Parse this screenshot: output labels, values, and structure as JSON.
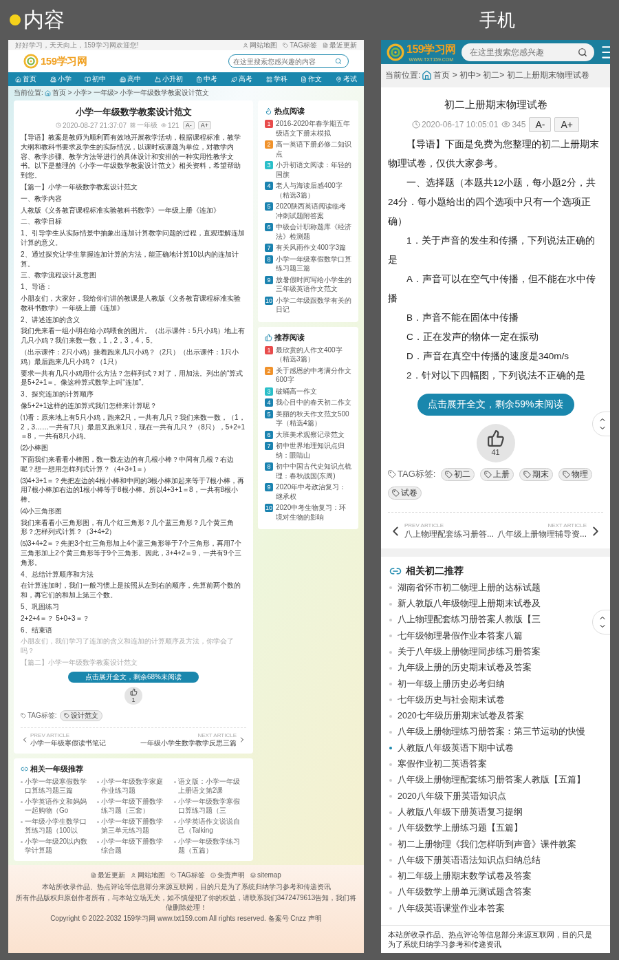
{
  "showcase_labels": {
    "desktop": "内容",
    "mobile": "手机"
  },
  "desktop": {
    "top_bar": {
      "greeting": "好好学习，天天向上，159学习网欢迎您!",
      "links": [
        "网站地图",
        "TAG标签",
        "最近更新"
      ]
    },
    "logo": {
      "name": "159学习网"
    },
    "search": {
      "placeholder": "在这里搜索您感兴趣的内容"
    },
    "nav": [
      "首页",
      "小学",
      "初中",
      "高中",
      "小升初",
      "中考",
      "高考",
      "学科",
      "作文",
      "考试"
    ],
    "breadcrumb": {
      "label": "当前位置:",
      "path": "首页 > 小学> 一年级> 小学一年级数学教案设计范文"
    },
    "article": {
      "title": "小学一年级数学教案设计范文",
      "date": "2020-08-27 21:37:07",
      "category": "一年级",
      "views": "121",
      "font_buttons": [
        "A-",
        "A+"
      ],
      "paragraphs": [
        {
          "kind": "text",
          "text": "【导语】教案是教师为顺利而有效地开展教学活动，根据课程标准，教学大纲和教科书要求及学生的实际情况，以课时或课题为单位，对教学内容、教学步骤、教学方法等进行的具体设计和安排的一种实用性教学文书。以下是整理的《小学一年级数学教案设计范文》相关资料，希望帮助到您。"
        },
        {
          "kind": "text",
          "text": "【篇一】小学一年级数学教案设计范文"
        },
        {
          "kind": "text",
          "text": "一、教学内容"
        },
        {
          "kind": "text",
          "text": "人教版《义务教育课程标准实验教科书数学》一年级上册《连加》"
        },
        {
          "kind": "text",
          "text": "二、教学目标"
        },
        {
          "kind": "text",
          "text": "1、引导学生从实际情景中抽象出连加计算教学问题的过程，直观理解连加计算的意义。"
        },
        {
          "kind": "text",
          "text": "2、通过探究让学生掌握连加计算的方法，能正确地计算10以内的连加计算。"
        },
        {
          "kind": "text",
          "text": "三、教学流程设计及意图"
        },
        {
          "kind": "text",
          "text": "1、导语："
        },
        {
          "kind": "text",
          "text": "小朋友们，大家好，我给你们讲的教课是人教版《义务教育课程标准实验教科书数学》一年级上册《连加》"
        },
        {
          "kind": "text",
          "text": "2、讲述连加的含义"
        },
        {
          "kind": "text",
          "text": "我们先来看一组小明在给小鸡喂食的图片。（出示课件：5只小鸡）地上有几只小鸡？我们来数一数，1，2，3，4，5。"
        },
        {
          "kind": "text",
          "text": "（出示课件：2只小鸡）接着跑来几只小鸡？（2只）（出示课件：1只小鸡）最后跑来几只小鸡？（1只）"
        },
        {
          "kind": "text",
          "text": "要求一共有几只小鸡用什么方法？怎样列式？对了，用加法。列出的“算式是5+2+1＝。像这种算式数学上叫“连加”。"
        },
        {
          "kind": "text",
          "text": "3、探究连加的计算顺序"
        },
        {
          "kind": "text",
          "text": "像5+2+1这样的连加算式我们怎样来计算呢？"
        },
        {
          "kind": "text",
          "text": "⑴看：原来地上有5只小鸡，跑来2只，一共有几只？我们来数一数，（1，2，3……一共有7只）最后又跑来1只，现在一共有几只？（8只），5+2+1＝8，一共有8只小鸡。"
        },
        {
          "kind": "text",
          "text": "⑵小棒图"
        },
        {
          "kind": "text",
          "text": "下面我们来看看小棒图，数一数左边的有几根小棒？中间有几根？右边呢？想一想用怎样列式计算？（4+3+1＝）"
        },
        {
          "kind": "text",
          "text": "⑶4+3+1＝？先把左边的4根小棒和中间的3根小棒加起来等于7根小棒，再用7根小棒加右边的1根小棒等于8根小棒。所以4+3+1＝8，一共有8根小棒。"
        },
        {
          "kind": "text",
          "text": "⑷小三角形图"
        },
        {
          "kind": "text",
          "text": "我们来看看小三角形图，有几个红三角形？几个蓝三角形？几个黄三角形？怎样列式计算？（3+4+2）"
        },
        {
          "kind": "text",
          "text": "⑸3+4+2＝？先把3个红三角形加上4个蓝三角形等于7个三角形，再用7个三角形加上2个黄三角形等于9个三角形。因此，3+4+2＝9，一共有9个三角形。"
        },
        {
          "kind": "text",
          "text": "4、总结计算顺序和方法"
        },
        {
          "kind": "text",
          "text": "在计算连加时，我们一般习惯上是按照从左到右的顺序，先算前两个数的和，再它们的和加上第三个数。"
        },
        {
          "kind": "text",
          "text": "5、巩固练习"
        },
        {
          "kind": "text",
          "text": "2+2+4＝？ 5+0+3＝？"
        },
        {
          "kind": "text",
          "text": "6、结束语"
        },
        {
          "kind": "faded",
          "text": "小朋友们，我们学习了连加的含义和连加的计算顺序及方法，你学会了吗？"
        },
        {
          "kind": "faded",
          "text": "【篇二】小学一年级数学教案设计范文"
        }
      ],
      "read_more": "点击展开全文，剩余68%未阅读",
      "likes": "1",
      "tag_label": "TAG标签:",
      "tags": [
        "设计范文"
      ],
      "prev": {
        "label": "PREV ARTICLE",
        "title": "小学一年级寒假读书笔记"
      },
      "next": {
        "label": "NEXT ARTICLE",
        "title": "一年级小学生数学教学反思三篇"
      }
    },
    "sidebar": [
      {
        "kind": "hot",
        "title": "热点阅读",
        "items": [
          {
            "rank": "1",
            "color": "#e84c4c",
            "title": "2016-2020年春学期五年级语文下册末模拟"
          },
          {
            "rank": "2",
            "color": "#f0922b",
            "title": "高一英语下册必修二知识点"
          },
          {
            "rank": "3",
            "color": "#2bbfc9",
            "title": "小升初语文阅读：年轻的国旗"
          },
          {
            "rank": "4",
            "color": "#1b83b0",
            "title": "老人与海读后感400字（精选3篇）"
          },
          {
            "rank": "5",
            "color": "#1b83b0",
            "title": "2020陕西英语阅读临考冲刺试题附答案"
          },
          {
            "rank": "6",
            "color": "#1b83b0",
            "title": "中级会计职称题库《经济法》检测题"
          },
          {
            "rank": "7",
            "color": "#1b83b0",
            "title": "有关风雨作文400字3篇"
          },
          {
            "rank": "8",
            "color": "#1b83b0",
            "title": "小学一年级寒假数学口算练习题三篇"
          },
          {
            "rank": "9",
            "color": "#1b83b0",
            "title": "放暑假时间写给小学生的三年级英语作文范文"
          },
          {
            "rank": "10",
            "color": "#1b83b0",
            "title": "小学二年级跟数学有关的日记"
          }
        ]
      },
      {
        "kind": "recommend",
        "title": "推荐阅读",
        "items": [
          {
            "rank": "1",
            "color": "#e84c4c",
            "title": "最欣赏的人作文400字（精选3篇）"
          },
          {
            "rank": "2",
            "color": "#f0922b",
            "title": "关于感恩的中考满分作文600字"
          },
          {
            "rank": "3",
            "color": "#2bbfc9",
            "title": "破蛹高一作文"
          },
          {
            "rank": "4",
            "color": "#1b83b0",
            "title": "我心目中的春天初二作文"
          },
          {
            "rank": "5",
            "color": "#1b83b0",
            "title": "美丽的秋天作文范文500字（精选4篇）"
          },
          {
            "rank": "6",
            "color": "#1b83b0",
            "title": "大班美术观察记录范文"
          },
          {
            "rank": "7",
            "color": "#1b83b0",
            "title": "初中世界地理知识点归纳：眼睛山"
          },
          {
            "rank": "8",
            "color": "#1b83b0",
            "title": "初中中国古代史知识点梳理：春秋战国(东周)"
          },
          {
            "rank": "9",
            "color": "#1b83b0",
            "title": "2020年中考政治复习：继承权"
          },
          {
            "rank": "10",
            "color": "#1b83b0",
            "title": "2020中考生物复习：环境对生物的影响"
          }
        ]
      }
    ],
    "related": {
      "title": "相关一年级推荐",
      "items": [
        "小学一年级寒假数学口算练习题三篇",
        "小学一年级数学家庭作业练习题",
        "语文版：小学一年级上册语文第2课",
        "小学英语作文和妈妈一起购物（Go",
        "小学一年级下册数学练习题（三套）",
        "小学一年级数学寒假口算练习题（三",
        "一年级小学生数学口算练习题（100以",
        "小学一年级下册数学第三单元练习题",
        "小学英语作文说说自己（Talking",
        "小学一年级20以内数学计算题",
        "小学一年级下册数学综合题",
        "小学一年级数学练习题（五篇）"
      ]
    },
    "footer": {
      "links": [
        "最近更新",
        "网站地图",
        "TAG标签",
        "免责声明",
        "sitemap"
      ],
      "lines": [
        "本站所收录作品、热点评论等信息部分来源互联网，目的只是为了系统归纳学习参考和传递资讯",
        "所有作品版权归原创作者所有，与本站立场无关，如不慎侵犯了你的权益，请联系我们3472479613告知，我们将做删除处理！",
        "Copyright © 2022-2032 159学习网 www.txt159.com All rights reserved. 备案号 Cnzz 声明"
      ]
    }
  },
  "mobile": {
    "logo": {
      "name": "159学习网",
      "subtitle": "WWW.TXT159.COM"
    },
    "search": {
      "placeholder": "在这里搜索您感兴趣"
    },
    "breadcrumb": {
      "label": "当前位置:",
      "path": "首页 > 初中> 初二> 初二上册期末物理试卷"
    },
    "article": {
      "title": "初二上册期末物理试卷",
      "date": "2020-06-17 10:05:01",
      "views": "345",
      "font_buttons": [
        "A-",
        "A+"
      ],
      "paragraphs": [
        "【导语】下面是免费为您整理的初二上册期末物理试卷，仅供大家参考。",
        "一、选择题（本题共12小题，每小题2分，共24分．每小题给出的四个选项中只有一个选项正确）",
        "1．关于声音的发生和传播，下列说法正确的是",
        "A．声音可以在空气中传播，但不能在水中传播",
        "B．声音不能在固体中传播",
        "C．正在发声的物体一定在振动",
        "D．声音在真空中传播的速度是340m/s",
        "2．针对以下四幅图，下列说法不正确的是"
      ],
      "read_more": "点击展开全文，剩余59%未阅读",
      "likes": "41",
      "tag_label": "TAG标签:",
      "tags": [
        "初二",
        "上册",
        "期末",
        "物理",
        "试卷"
      ],
      "prev": {
        "label": "PREV ARTICLE",
        "title": "八上物理配套练习册答..."
      },
      "next": {
        "label": "NEXT ARTICLE",
        "title": "八年级上册物理辅导资..."
      }
    },
    "related": {
      "title": "相关初二推荐",
      "items": [
        {
          "title": "湖南省怀市初二物理上册的达标试题",
          "selected": false
        },
        {
          "title": "新人教版八年级物理上册期末试卷及",
          "selected": false
        },
        {
          "title": "八上物理配套练习册答案人教版【三",
          "selected": false
        },
        {
          "title": "七年级物理暑假作业本答案八篇",
          "selected": false
        },
        {
          "title": "关于八年级上册物理同步练习册答案",
          "selected": false
        },
        {
          "title": "九年级上册的历史期末试卷及答案",
          "selected": false
        },
        {
          "title": "初一年级上册历史必考归纳",
          "selected": false
        },
        {
          "title": "七年级历史与社会期末试卷",
          "selected": false
        },
        {
          "title": "2020七年级历册期末试卷及答案",
          "selected": false
        },
        {
          "title": "八年级上册物理练习册答案：第三节运动的快慢",
          "selected": false
        },
        {
          "title": "人教版八年级英语下期中试卷",
          "selected": true
        },
        {
          "title": "寒假作业初二英语答案",
          "selected": false
        },
        {
          "title": "八年级上册物理配套练习册答案人教版【五篇】",
          "selected": false
        },
        {
          "title": "2020八年级下册英语知识点",
          "selected": false
        },
        {
          "title": "人教版八年级下册英语复习提纲",
          "selected": false
        },
        {
          "title": "八年级数学上册练习题【五篇】",
          "selected": false
        },
        {
          "title": "初二上册物理《我们怎样听到声音》课件教案",
          "selected": false
        },
        {
          "title": "八年级下册英语语法知识点归纳总结",
          "selected": false
        },
        {
          "title": "初二年级上册期末数学试卷及答案",
          "selected": false
        },
        {
          "title": "八年级数学上册单元测试题含答案",
          "selected": false
        },
        {
          "title": "八年级英语课堂作业本答案",
          "selected": false
        }
      ]
    },
    "footer_lines": [
      "本站所收录作品、热点评论等信息部分来源互联网，目的只是",
      "为了系统归纳学习参考和传递资讯"
    ]
  }
}
